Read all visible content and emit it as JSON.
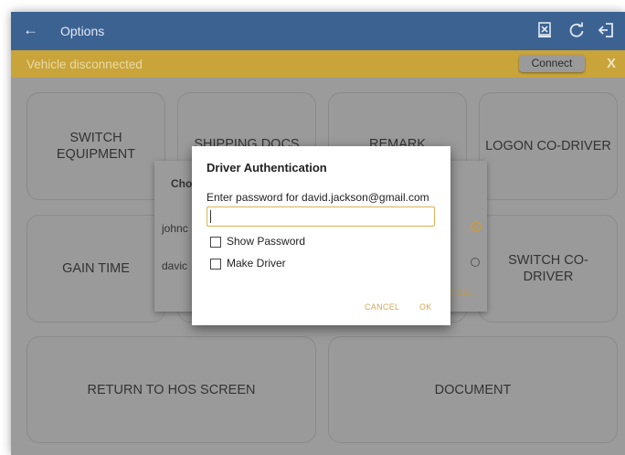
{
  "appbar": {
    "back_icon": "arrow-left-icon",
    "title": "Options",
    "icons": [
      "download-icon",
      "refresh-icon",
      "logout-icon"
    ]
  },
  "banner": {
    "message": "Vehicle disconnected",
    "connect_label": "Connect",
    "close_label": "X",
    "color": "#c9a43a"
  },
  "tiles": {
    "switch_equipment": [
      "SWITCH",
      "EQUIPMENT"
    ],
    "shipping_docs": "SHIPPING DOCS",
    "remark": "REMARK",
    "logon_codriver": "LOGON CO-DRIVER",
    "gain_time": "GAIN TIME",
    "switch_codriver": [
      "SWITCH CO-",
      "DRIVER"
    ],
    "return_hos": "RETURN TO HOS SCREEN",
    "document": "DOCUMENT"
  },
  "chooser": {
    "title_fragment": "Cho",
    "users": [
      "johnc",
      "davic"
    ],
    "cancel_fragment": "NCEL"
  },
  "auth_dialog": {
    "title": "Driver Authentication",
    "prompt": "Enter password for david.jackson@gmail.com",
    "password_value": "",
    "show_password_label": "Show Password",
    "make_driver_label": "Make Driver",
    "cancel_label": "CANCEL",
    "ok_label": "OK",
    "accent": "#d4a752"
  }
}
